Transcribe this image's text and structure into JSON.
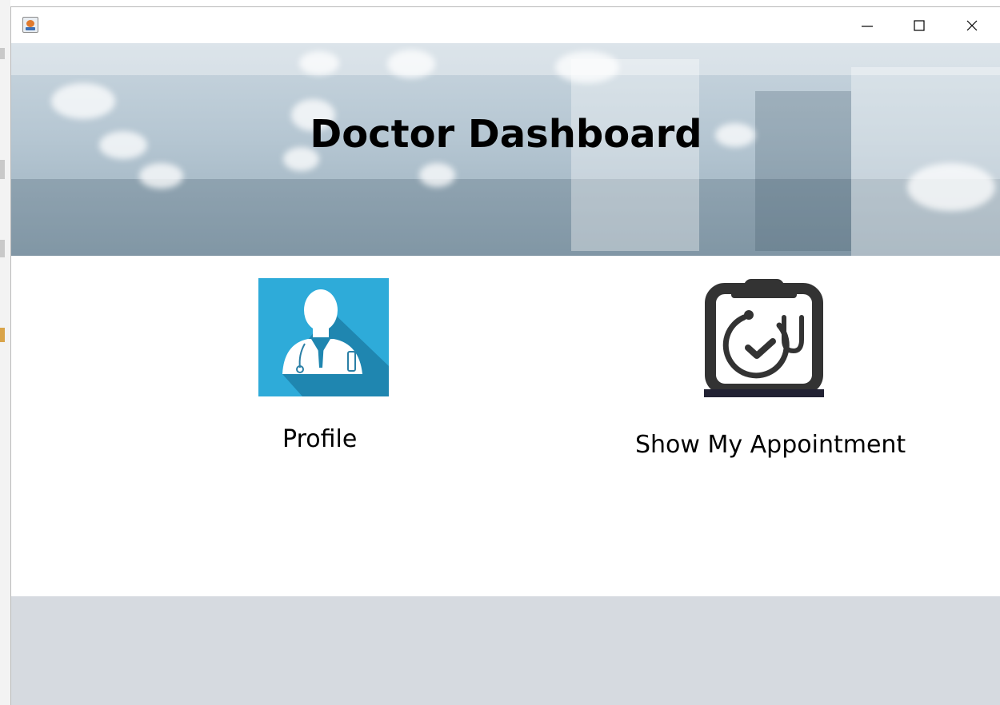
{
  "window": {
    "controls": {
      "minimize": "minimize-icon",
      "maximize": "maximize-icon",
      "close": "close-icon"
    },
    "app_icon": "java-app-icon"
  },
  "banner": {
    "title": "Doctor Dashboard"
  },
  "tiles": [
    {
      "label": "Profile",
      "icon": "doctor-avatar-icon",
      "icon_bg": "#2eabd9"
    },
    {
      "label": "Show My Appointment",
      "icon": "clipboard-stethoscope-icon"
    }
  ],
  "colors": {
    "footer": "#d6dae0",
    "profile_icon_bg": "#2eabd9",
    "clipboard_dark": "#333333"
  }
}
